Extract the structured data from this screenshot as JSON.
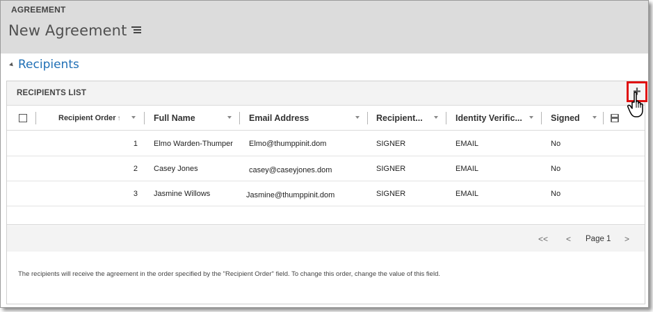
{
  "form": {
    "entity_label": "AGREEMENT",
    "record_title": "New Agreement",
    "title_menu_icon": "hamburger-menu-icon"
  },
  "section": {
    "title": "Recipients",
    "collapse_icon": "collapse-triangle-icon"
  },
  "subgrid": {
    "title": "RECIPIENTS LIST",
    "add_button": "+",
    "add_icon": "plus-icon",
    "pointer_icon": "hand-pointer-icon",
    "columns": [
      {
        "label": "Recipient Order",
        "sort": "↑"
      },
      {
        "label": "Full Name"
      },
      {
        "label": "Email Address"
      },
      {
        "label": "Recipient..."
      },
      {
        "label": "Identity Verific..."
      },
      {
        "label": "Signed"
      }
    ],
    "save_icon": "save-icon",
    "rows": [
      {
        "order": "1",
        "name": "Elmo Warden-Thumper",
        "email": "Elmo@thumppinit.dom",
        "role": "SIGNER",
        "verification": "EMAIL",
        "signed": "No"
      },
      {
        "order": "2",
        "name": "Casey Jones",
        "email": "casey@caseyjones.dom",
        "role": "SIGNER",
        "verification": "EMAIL",
        "signed": "No"
      },
      {
        "order": "3",
        "name": "Jasmine Willows",
        "email": "Jasmine@thumppinit.dom",
        "role": "SIGNER",
        "verification": "EMAIL",
        "signed": "No"
      }
    ],
    "pager": {
      "first": "<<",
      "prev": "<",
      "page_label": "Page 1",
      "next": ">"
    },
    "note": "The recipients will receive the agreement in the order specified by the \"Recipient Order\" field. To change this order, change the value of this field."
  },
  "colors": {
    "accent": "#1f6fb5",
    "header_bg": "#dcdcdc",
    "highlight": "#e01010"
  }
}
